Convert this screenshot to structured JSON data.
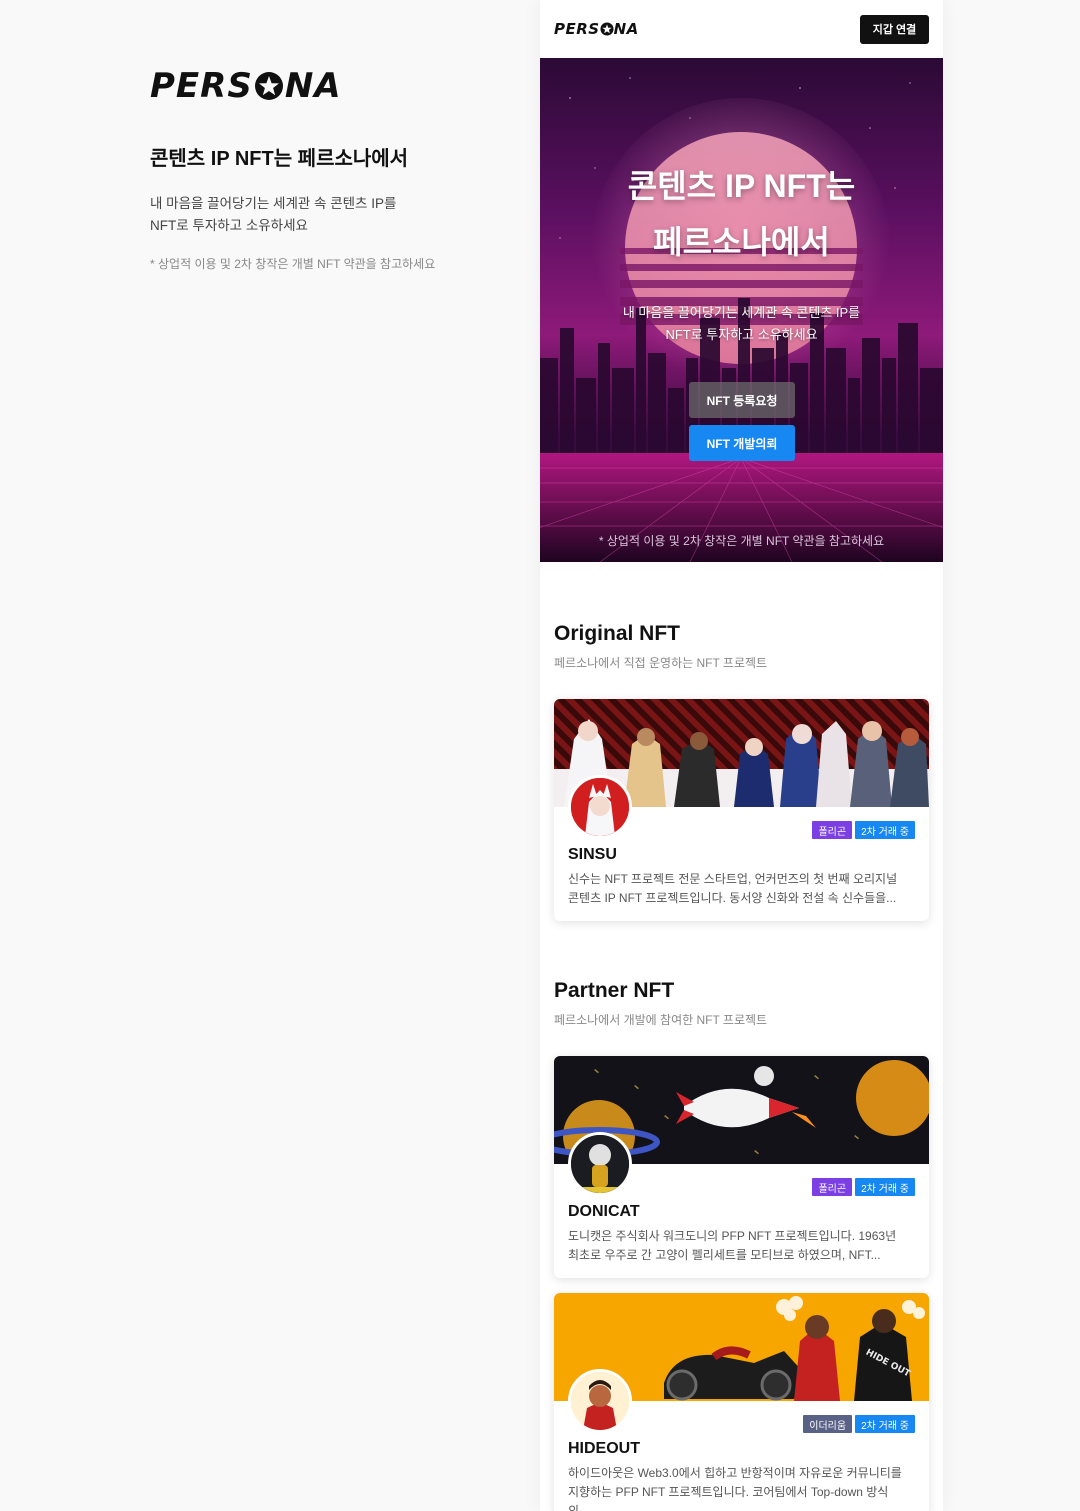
{
  "intro": {
    "logo": "PERSONA",
    "title": "콘텐츠 IP NFT는 페르소나에서",
    "desc_line1": "내 마음을 끌어당기는 세계관 속 콘텐츠 IP를",
    "desc_line2": "NFT로 투자하고 소유하세요",
    "note": "* 상업적 이용 및 2차 창작은 개별 NFT 약관을 참고하세요"
  },
  "header": {
    "logo": "PERSONA",
    "wallet_button": "지갑 연결"
  },
  "hero": {
    "title_line1": "콘텐츠 IP NFT는",
    "title_line2": "페르소나에서",
    "sub_line1": "내 마음을 끌어당기는 세계관 속 콘텐츠 IP를",
    "sub_line2": "NFT로 투자하고 소유하세요",
    "register_button": "NFT 등록요청",
    "dev_button": "NFT 개발의뢰",
    "note": "* 상업적 이용 및 2차 창작은 개별 NFT 약관을 참고하세요"
  },
  "original": {
    "title": "Original NFT",
    "subtitle": "페르소나에서 직접 운영하는 NFT 프로젝트",
    "cards": [
      {
        "name": "SINSU",
        "chain": "폴리곤",
        "status": "2차 거래 중",
        "desc_line1": "신수는 NFT 프로젝트 전문 스타트업, 언커먼즈의 첫 번째 오리지널",
        "desc_line2": "콘텐츠 IP NFT 프로젝트입니다. 동서양 신화와 전설 속 신수들을..."
      }
    ]
  },
  "partner": {
    "title": "Partner NFT",
    "subtitle": "페르소나에서 개발에 참여한 NFT 프로젝트",
    "cards": [
      {
        "name": "DONICAT",
        "chain": "폴리곤",
        "status": "2차 거래 중",
        "desc_line1": "도니캣은 주식회사 워크도니의 PFP NFT 프로젝트입니다. 1963년",
        "desc_line2": "최초로 우주로 간 고양이 펠리세트를 모티브로 하였으며, NFT..."
      },
      {
        "name": "HIDEOUT",
        "chain": "이더리움",
        "status": "2차 거래 중",
        "desc_line1": "하이드아웃은 Web3.0에서 힙하고 반항적이며 자유로운 커뮤니티를",
        "desc_line2": "지향하는 PFP NFT 프로젝트입니다. 코어팀에서 Top-down 방식의..."
      }
    ]
  },
  "colors": {
    "accent_blue": "#1787f2",
    "polygon_purple": "#7b3fe4",
    "ethereum_slate": "#596185",
    "hideout_orange": "#f7a600"
  }
}
